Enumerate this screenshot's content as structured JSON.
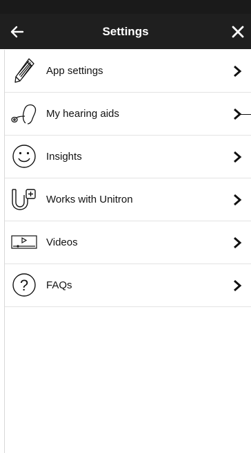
{
  "header": {
    "title": "Settings",
    "background": "#1f1f1f",
    "back_icon": "arrow-left-icon",
    "close_icon": "close-icon"
  },
  "menu": {
    "items": [
      {
        "label": "App settings",
        "icon": "pencil-icon"
      },
      {
        "label": "My hearing aids",
        "icon": "hearing-aid-icon"
      },
      {
        "label": "Insights",
        "icon": "smiley-icon"
      },
      {
        "label": "Works with Unitron",
        "icon": "unitron-plus-icon"
      },
      {
        "label": "Videos",
        "icon": "video-player-icon"
      },
      {
        "label": "FAQs",
        "icon": "question-circle-icon"
      }
    ],
    "chevron_icon": "chevron-right-icon"
  }
}
